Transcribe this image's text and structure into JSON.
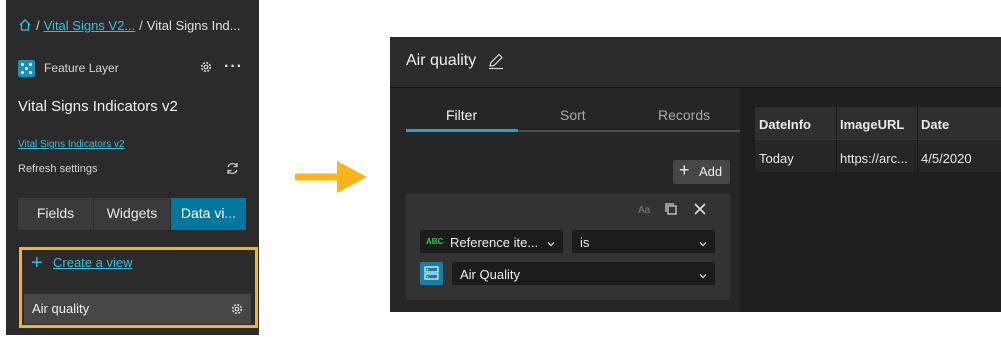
{
  "breadcrumb": {
    "layer_short": "Vital Signs V2...",
    "current": "Vital Signs Ind..."
  },
  "layer": {
    "type_label": "Feature Layer",
    "title": "Vital Signs Indicators v2",
    "link_text": "Vital Signs Indicators v2",
    "refresh_label": "Refresh settings"
  },
  "left_tabs": [
    {
      "label": "Fields"
    },
    {
      "label": "Widgets"
    },
    {
      "label": "Data vi..."
    }
  ],
  "create_view": {
    "plus": "+",
    "label": "Create a view"
  },
  "views": [
    {
      "label": "Air quality"
    }
  ],
  "view_panel": {
    "title": "Air quality",
    "tabs": [
      {
        "label": "Filter"
      },
      {
        "label": "Sort"
      },
      {
        "label": "Records"
      }
    ],
    "add_button": {
      "plus": "+",
      "label": "Add"
    },
    "clause": {
      "case_icon": "Aa",
      "field_type": "ABC",
      "field": "Reference ite...",
      "operator": "is",
      "value": "Air Quality"
    }
  },
  "table": {
    "columns": [
      "DateInfo",
      "ImageURL",
      "Date"
    ],
    "rows": [
      [
        "Today",
        "https://arc...",
        "4/5/2020"
      ]
    ]
  },
  "colors": {
    "accent": "#00779f",
    "link": "#35c0e0",
    "highlight": "#f5b51b",
    "arrow": "#f5b51b"
  }
}
